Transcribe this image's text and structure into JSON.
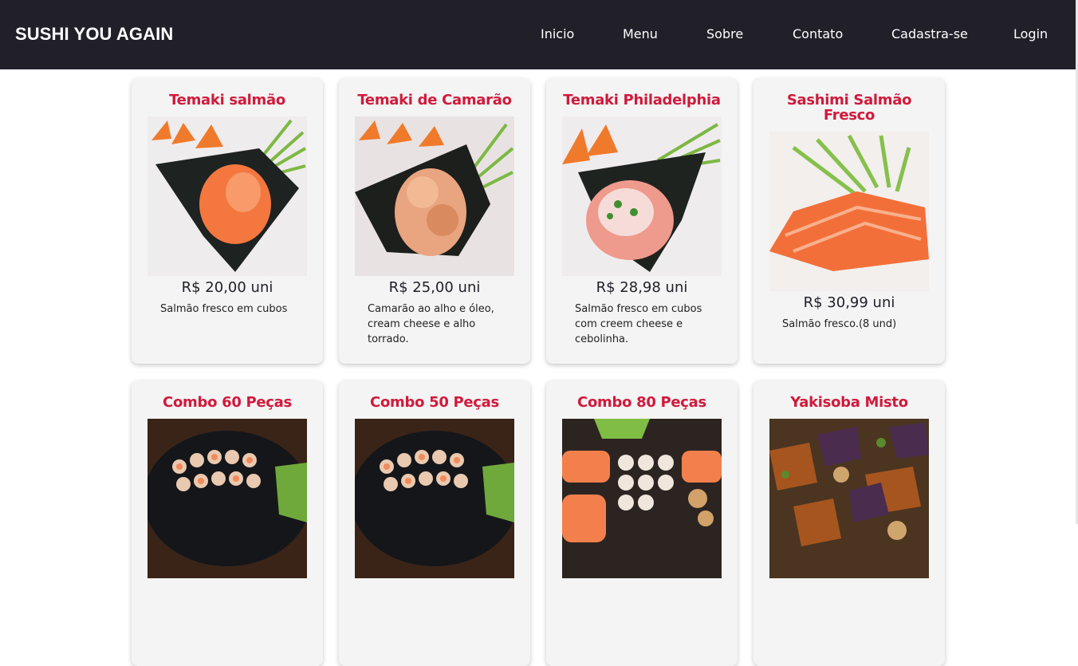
{
  "header": {
    "brand": "SUSHI YOU AGAIN",
    "nav": [
      "Inicio",
      "Menu",
      "Sobre",
      "Contato",
      "Cadastra-se",
      "Login"
    ]
  },
  "products": [
    {
      "title": "Temaki salmão",
      "price": "R$ 20,00 uni",
      "description": "Salmão fresco em cubos"
    },
    {
      "title": "Temaki de Camarão",
      "price": "R$ 25,00 uni",
      "description": "Camarão ao alho e óleo, cream cheese e alho torrado."
    },
    {
      "title": "Temaki Philadelphia",
      "price": "R$ 28,98 uni",
      "description": "Salmão fresco em cubos com creem cheese e cebolinha."
    },
    {
      "title": "Sashimi Salmão Fresco",
      "price": "R$ 30,99 uni",
      "description": "Salmão fresco.(8 und)"
    },
    {
      "title": "Combo 60 Peças"
    },
    {
      "title": "Combo 50 Peças"
    },
    {
      "title": "Combo 80 Peças"
    },
    {
      "title": "Yakisoba Misto"
    }
  ],
  "colors": {
    "header_bg": "#212029",
    "accent": "#d01a3c",
    "card_bg": "#f4f4f4"
  }
}
